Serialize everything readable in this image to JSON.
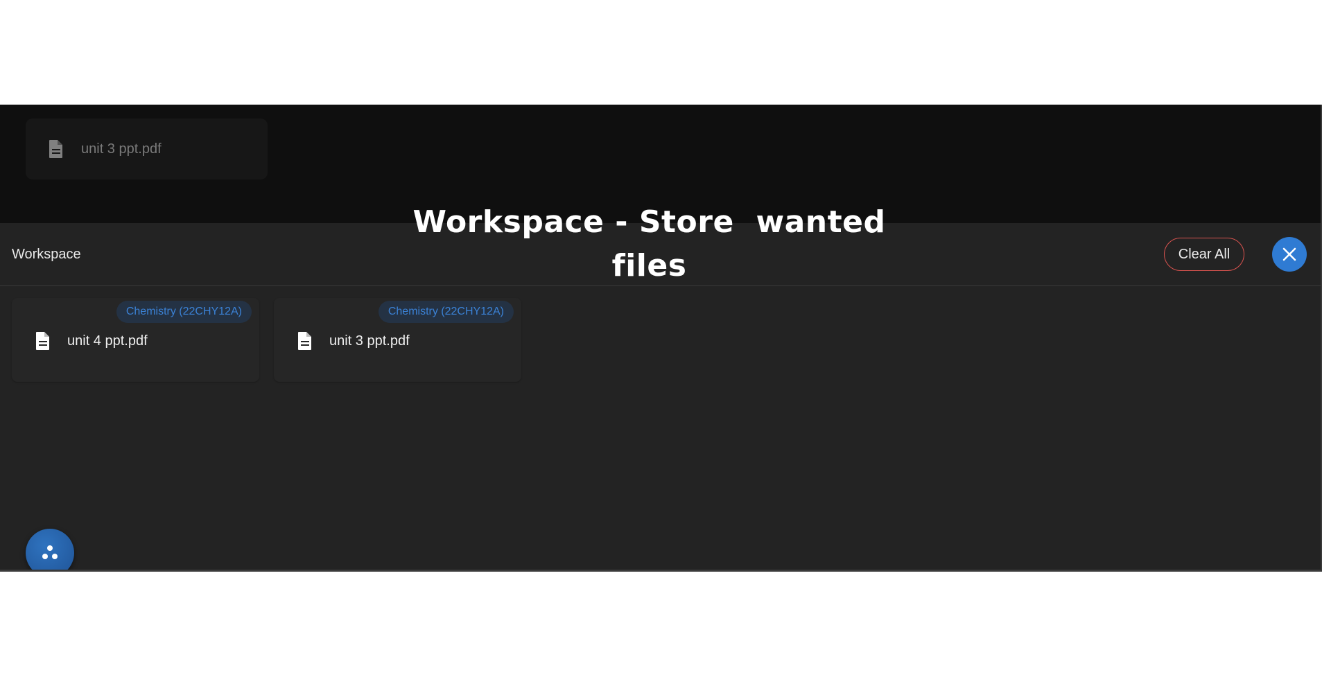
{
  "background_item": {
    "icon": "file-icon",
    "name": "unit 3 ppt.pdf"
  },
  "workspace": {
    "title": "Workspace",
    "clear_label": "Clear All",
    "close_icon": "close-icon",
    "accent_color": "#2f7bd3",
    "danger_color": "#d9534f",
    "files": [
      {
        "tag": "Chemistry (22CHY12A)",
        "icon": "file-icon",
        "name": "unit 4 ppt.pdf"
      },
      {
        "tag": "Chemistry (22CHY12A)",
        "icon": "file-icon",
        "name": "unit 3 ppt.pdf"
      }
    ],
    "fab_icon": "three-dots-icon"
  },
  "overlay": {
    "caption": "Workspace - Store  wanted\nfiles"
  }
}
